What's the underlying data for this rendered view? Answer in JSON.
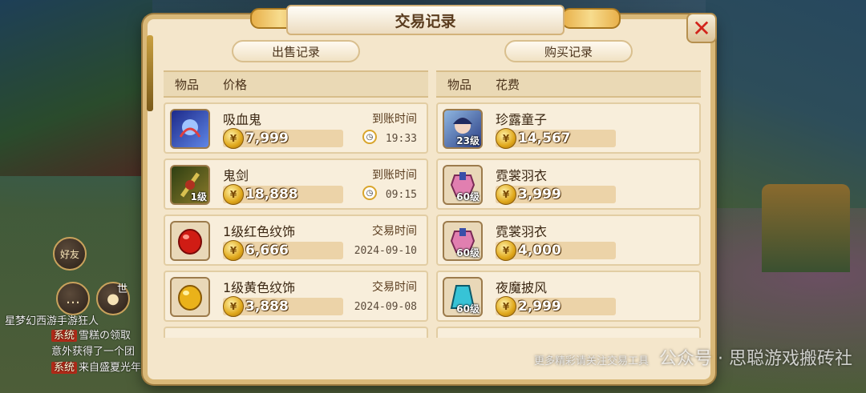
{
  "dialog": {
    "title": "交易记录",
    "close_icon": "close-x-icon"
  },
  "sell": {
    "header": "出售记录",
    "col_item": "物品",
    "col_price": "价格",
    "rows": [
      {
        "name": "吸血鬼",
        "price": "7,999",
        "time_label": "到账时间",
        "time": "19:33",
        "icon": "vampire-pet-icon",
        "level": "",
        "color": "#3b5bd1"
      },
      {
        "name": "鬼剑",
        "price": "18,888",
        "time_label": "到账时间",
        "time": "09:15",
        "icon": "ghost-sword-icon",
        "level": "1级",
        "color": "#4c6a1e"
      },
      {
        "name": "1级红色纹饰",
        "price": "6,666",
        "time_label": "交易时间",
        "time": "2024-09-10",
        "icon": "red-gem-icon",
        "level": "",
        "color": "#d12a1e"
      },
      {
        "name": "1级黄色纹饰",
        "price": "3,888",
        "time_label": "交易时间",
        "time": "2024-09-08",
        "icon": "yellow-gem-icon",
        "level": "",
        "color": "#e8b21a"
      }
    ]
  },
  "buy": {
    "header": "购买记录",
    "col_item": "物品",
    "col_price": "花费",
    "rows": [
      {
        "name": "珍露童子",
        "price": "14,567",
        "icon": "child-pet-icon",
        "level": "23级",
        "color": "#3b5fa8"
      },
      {
        "name": "霓裳羽衣",
        "price": "3,999",
        "icon": "pink-armor-icon",
        "level": "60级",
        "color": "#d86aa0"
      },
      {
        "name": "霓裳羽衣",
        "price": "4,000",
        "icon": "pink-armor-icon",
        "level": "60级",
        "color": "#d86aa0"
      },
      {
        "name": "夜魔披风",
        "price": "2,999",
        "icon": "cyan-cloak-icon",
        "level": "60级",
        "color": "#2fb5c8"
      }
    ]
  },
  "side": {
    "friend": "好友",
    "voice": "世",
    "chat": [
      {
        "tag": "",
        "text": "星梦幻西游手游狂人"
      },
      {
        "tag": "系统",
        "text": "雪糕の领取"
      },
      {
        "tag": "",
        "text": "意外获得了一个团"
      },
      {
        "tag": "系统",
        "text": "来自盛夏光年"
      }
    ]
  },
  "watermark": {
    "small": "更多精彩请关注交易工具",
    "main": "公众号 · 思聪游戏搬砖社"
  }
}
